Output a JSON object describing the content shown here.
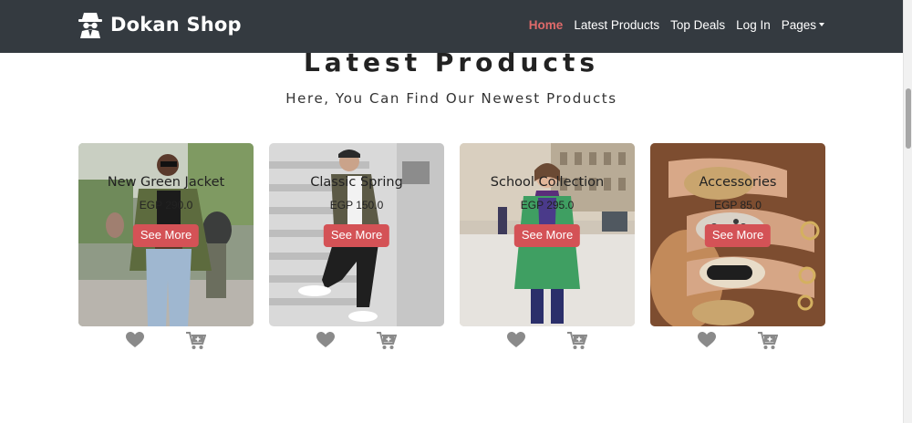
{
  "navbar": {
    "brand": "Dokan Shop",
    "brand_icon": "spy-icon",
    "links": [
      {
        "label": "Home",
        "active": true
      },
      {
        "label": "Latest Products",
        "active": false
      },
      {
        "label": "Top Deals",
        "active": false
      },
      {
        "label": "Log In",
        "active": false
      },
      {
        "label": "Pages",
        "active": false,
        "dropdown": true
      }
    ]
  },
  "section": {
    "title": "Latest Products",
    "subtitle": "Here, You Can Find Our Newest Products"
  },
  "products": [
    {
      "name": "New Green Jacket",
      "price": "EGP 290.0",
      "button": "See More",
      "image": "woman in green jacket and jeans on street"
    },
    {
      "name": "Classic Spring",
      "price": "EGP 150.0",
      "button": "See More",
      "image": "man in camouflage jacket sitting on stairs"
    },
    {
      "name": "School Collection",
      "price": "EGP 295.0",
      "button": "See More",
      "image": "girl in green checked coat and purple scarf"
    },
    {
      "name": "Accessories",
      "price": "EGP 85.0",
      "button": "See More",
      "image": "gold glitter manicured nails with rings"
    }
  ],
  "colors": {
    "navbar_bg": "#343a40",
    "active_link": "#e06a6a",
    "button_bg": "#d45256",
    "icon_gray": "#8a8a8a"
  }
}
